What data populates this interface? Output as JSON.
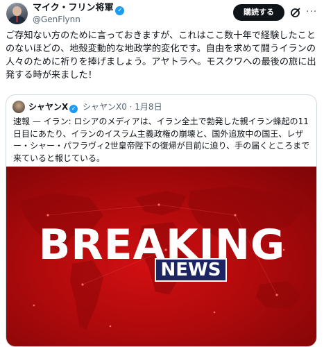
{
  "author": {
    "display_name": "マイク・フリン将軍",
    "handle": "@GenFlynn",
    "verified_mark": "✓"
  },
  "actions": {
    "subscribe_label": "購読する",
    "more_glyph": "···"
  },
  "tweet": {
    "text": "ご存知ない方のために言っておきますが、これはここ数十年で経験したことのないほどの、地殻変動的な地政学的変化です。自由を求めて闘うイランの人々のために祈りを捧げましょう。アヤトラへ。モスクワへの最後の旅に出発する時が来ました！"
  },
  "quote": {
    "display_name": "シャヤンX",
    "verified_mark": "✓",
    "meta": "シャヤンX0 · 1月8日",
    "text": "速報 — イラン: ロシアのメディアは、イラン全土で勃発した親イラン蜂起の11日目にあたり、イランのイスラム主義政権の崩壊と、国外追放中の国王、レザー・シャー・パフラヴィ2世皇帝陛下の復帰が目前に迫り、手の届くところまで来ていると報じている。",
    "image": {
      "breaking_word": "BREAKING",
      "news_word": "NEWS"
    }
  },
  "colors": {
    "accent_blue": "#1d9bf0",
    "breaking_red": "#c40c0e",
    "news_navy": "#1c2464",
    "text_primary": "#0f1419",
    "text_secondary": "#536471"
  },
  "icons": [
    "grok-icon",
    "more-icon",
    "verified-badge-icon"
  ]
}
